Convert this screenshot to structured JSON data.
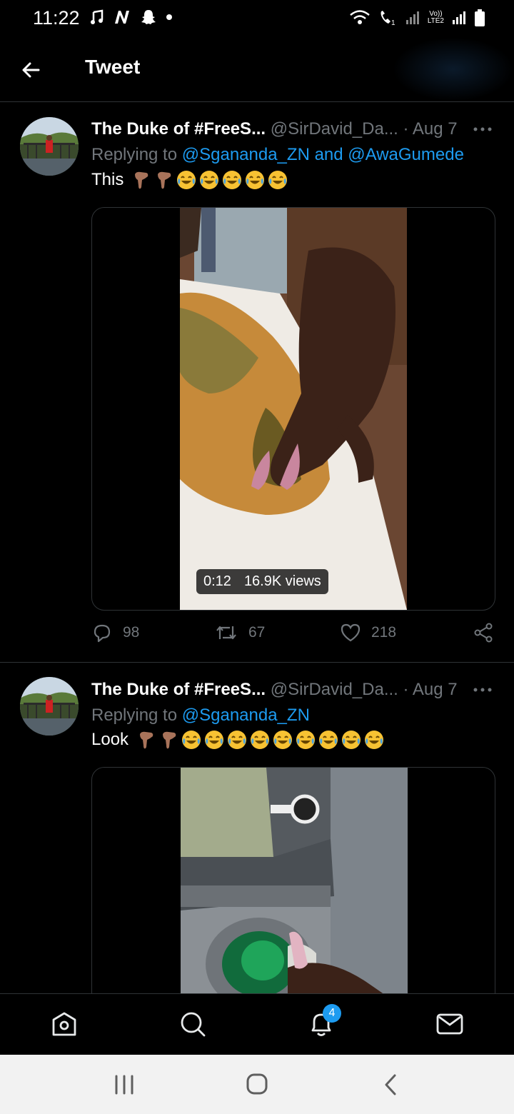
{
  "status_bar": {
    "time": "11:22",
    "left_icons": [
      "music-note-icon",
      "n-app-icon",
      "snapchat-icon",
      "dot-icon"
    ],
    "right_icons": [
      "wifi-icon",
      "wifi-calling-icon",
      "signal-icon",
      "volte-icon",
      "signal-icon",
      "battery-icon"
    ],
    "volte_top": "Vo))",
    "volte_bottom": "LTE2"
  },
  "header": {
    "title": "Tweet",
    "back_icon": "arrow-left-icon"
  },
  "tweets": [
    {
      "author": "The Duke of #FreeS...",
      "handle": "@SirDavid_Da...",
      "date": "· Aug 7",
      "reply_prefix": "Replying to",
      "mentions": "@Sgananda_ZN and @AwaGumede",
      "text": "This",
      "emojis": [
        "point-down-icon",
        "point-down-icon",
        "joy-icon",
        "joy-icon",
        "joy-icon",
        "joy-icon",
        "joy-icon"
      ],
      "video": {
        "duration": "0:12",
        "views": "16.9K views"
      },
      "replies": "98",
      "retweets": "67",
      "likes": "218"
    },
    {
      "author": "The Duke of #FreeS...",
      "handle": "@SirDavid_Da...",
      "date": "· Aug 7",
      "reply_prefix": "Replying to",
      "mentions": "@Sgananda_ZN",
      "text": "Look",
      "emojis": [
        "point-down-icon",
        "point-down-icon",
        "joy-icon",
        "joy-icon",
        "joy-icon",
        "joy-icon",
        "joy-icon",
        "joy-icon",
        "joy-icon",
        "joy-icon"
      ]
    }
  ],
  "bottom_nav": {
    "items": [
      "home-icon",
      "search-icon",
      "notifications-icon",
      "messages-icon"
    ],
    "notification_count": "4"
  },
  "system_nav": [
    "recents-icon",
    "home-circle-icon",
    "back-chevron-icon"
  ],
  "colors": {
    "accent": "#1d9bf0",
    "background": "#000000",
    "muted": "#71767b",
    "divider": "#2f3336"
  }
}
